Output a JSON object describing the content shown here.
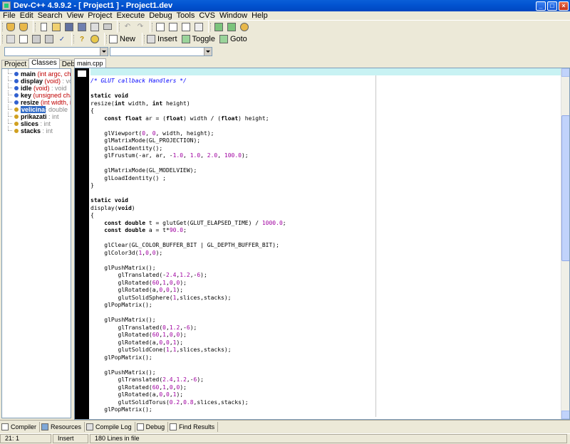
{
  "window": {
    "title": "Dev-C++ 4.9.9.2  - [ Project1 ] - Project1.dev"
  },
  "menu": [
    "File",
    "Edit",
    "Search",
    "View",
    "Project",
    "Execute",
    "Debug",
    "Tools",
    "CVS",
    "Window",
    "Help"
  ],
  "toolbar2": {
    "new_label": "New",
    "insert_label": "Insert",
    "toggle_label": "Toggle",
    "goto_label": "Goto"
  },
  "left_tabs": [
    "Project",
    "Classes",
    "Debug"
  ],
  "class_items": [
    {
      "name": "main",
      "sig": " (int argc, char *ar",
      "type": ""
    },
    {
      "name": "display",
      "sig": " (void)",
      "type": " : void"
    },
    {
      "name": "idle",
      "sig": " (void)",
      "type": " : void"
    },
    {
      "name": "key",
      "sig": " (unsigned char key",
      "type": ""
    },
    {
      "name": "resize",
      "sig": " (int width, int he",
      "type": ""
    },
    {
      "name": "velicina",
      "sig": "",
      "type": " : double"
    },
    {
      "name": "prikazati",
      "sig": "",
      "type": " : int"
    },
    {
      "name": "slices",
      "sig": "",
      "type": " : int"
    },
    {
      "name": "stacks",
      "sig": "",
      "type": " : int"
    }
  ],
  "editor": {
    "tab": "main.cpp",
    "lines": [
      "/* GLUT callback Handlers */",
      "",
      "static void",
      "resize(int width, int height)",
      "{",
      "    const float ar = (float) width / (float) height;",
      "",
      "    glViewport(0, 0, width, height);",
      "    glMatrixMode(GL_PROJECTION);",
      "    glLoadIdentity();",
      "    glFrustum(-ar, ar, -1.0, 1.0, 2.0, 100.0);",
      "",
      "    glMatrixMode(GL_MODELVIEW);",
      "    glLoadIdentity() ;",
      "}",
      "",
      "static void",
      "display(void)",
      "{",
      "    const double t = glutGet(GLUT_ELAPSED_TIME) / 1000.0;",
      "    const double a = t*90.0;",
      "",
      "    glClear(GL_COLOR_BUFFER_BIT | GL_DEPTH_BUFFER_BIT);",
      "    glColor3d(1,0,0);",
      "",
      "    glPushMatrix();",
      "        glTranslated(-2.4,1.2,-6);",
      "        glRotated(60,1,0,0);",
      "        glRotated(a,0,0,1);",
      "        glutSolidSphere(1,slices,stacks);",
      "    glPopMatrix();",
      "",
      "    glPushMatrix();",
      "        glTranslated(0,1.2,-6);",
      "        glRotated(60,1,0,0);",
      "        glRotated(a,0,0,1);",
      "        glutSolidCone(1,1,slices,stacks);",
      "    glPopMatrix();",
      "",
      "    glPushMatrix();",
      "        glTranslated(2.4,1.2,-6);",
      "        glRotated(60,1,0,0);",
      "        glRotated(a,0,0,1);",
      "        glutSolidTorus(0.2,0.8,slices,stacks);",
      "    glPopMatrix();"
    ]
  },
  "bottom_tabs": [
    "Compiler",
    "Resources",
    "Compile Log",
    "Debug",
    "Find Results"
  ],
  "status": {
    "position": "21: 1",
    "mode": "Insert",
    "info": "180 Lines in file"
  }
}
